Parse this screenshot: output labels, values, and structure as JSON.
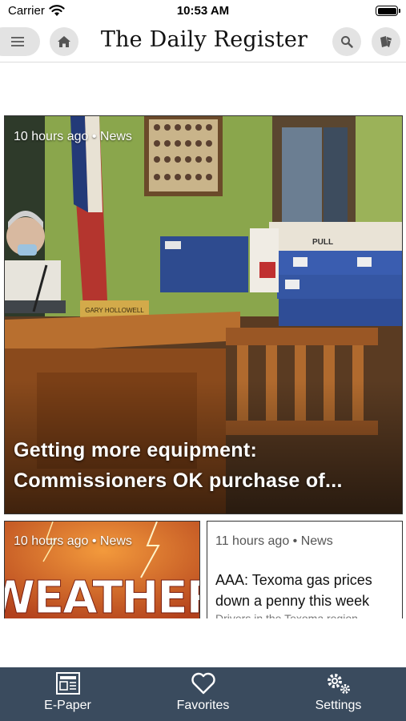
{
  "status_bar": {
    "carrier": "Carrier",
    "time": "10:53 AM"
  },
  "header": {
    "masthead": "The Daily Register"
  },
  "hero": {
    "meta": "10 hours ago • News",
    "title": "Getting more equipment: Commissioners OK purchase of...",
    "nameplate": "GARY HOLLOWELL",
    "box_label": "PULL"
  },
  "cards": [
    {
      "meta": "10 hours ago • News",
      "image_text": "WEATHER"
    },
    {
      "meta": "11 hours ago • News",
      "title": "AAA: Texoma gas prices down a penny this week",
      "snippet": "Drivers in the Texoma region"
    }
  ],
  "tab_bar": {
    "items": [
      {
        "label": "E-Paper",
        "icon": "newspaper-icon"
      },
      {
        "label": "Favorites",
        "icon": "heart-icon"
      },
      {
        "label": "Settings",
        "icon": "gears-icon"
      }
    ]
  },
  "colors": {
    "tab_bar_bg": "#3a4b5e",
    "header_button_bg": "#e3e3e3"
  }
}
